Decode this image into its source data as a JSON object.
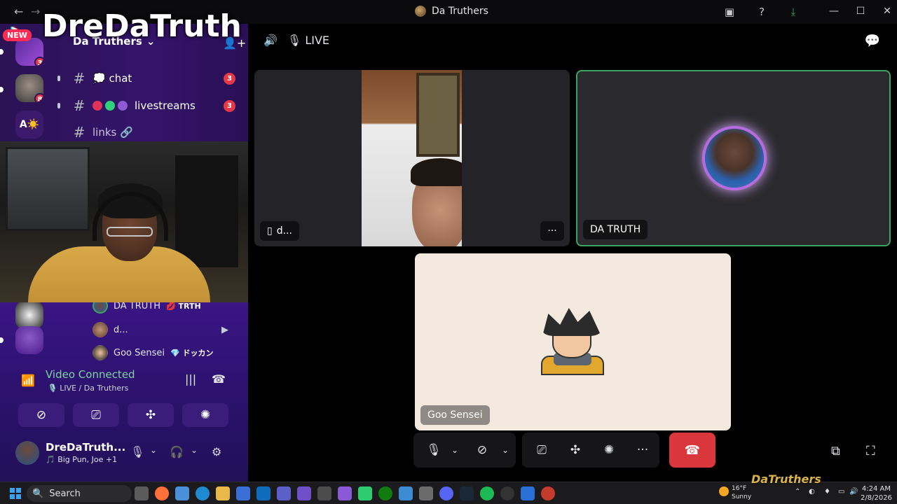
{
  "window": {
    "title": "Da Truthers",
    "back": "←",
    "forward": "→",
    "minimize": "—",
    "maximize": "☐",
    "close": "✕"
  },
  "overlay": {
    "brand_name": "DreDaTruth",
    "new_badge": "NEW"
  },
  "server_rail": [
    {
      "badge": "3",
      "color": "#7a3cc4"
    },
    {
      "badge": "8",
      "color": "#555a66"
    },
    {
      "label": "A☀️",
      "color": "#3b1a6b"
    }
  ],
  "server_header": {
    "name": "Da Truthers",
    "chevron": "⌄"
  },
  "channels": [
    {
      "name": "💭 chat",
      "badge": "3"
    },
    {
      "name": "livestreams",
      "badge": "3"
    },
    {
      "name": "links 🔗"
    }
  ],
  "voice_members": [
    {
      "name": "DA TRUTH",
      "tag": "💋 TRTH"
    },
    {
      "name": "d...",
      "tag": ""
    },
    {
      "name": "Goo Sensei",
      "tag": "💎 ドッカン"
    }
  ],
  "voice_status": {
    "title": "Video Connected",
    "subtitle": "🎙️ LIVE / Da Truthers"
  },
  "user": {
    "name": "DreDaTruth...",
    "activity": "🎵 Big Pun, Joe +1"
  },
  "call": {
    "channel_name": "LIVE",
    "tiles": [
      {
        "label": "d...",
        "speaking": false
      },
      {
        "label": "DA TRUTH",
        "speaking": true
      },
      {
        "label": "Goo Sensei",
        "speaking": false
      }
    ],
    "more": "···"
  },
  "taskbar": {
    "search_placeholder": "Search",
    "weather_temp": "16°F",
    "weather_desc": "Sunny",
    "time": "4:24 AM",
    "date": "2/8/2026",
    "watermark": "DaTruthers"
  }
}
